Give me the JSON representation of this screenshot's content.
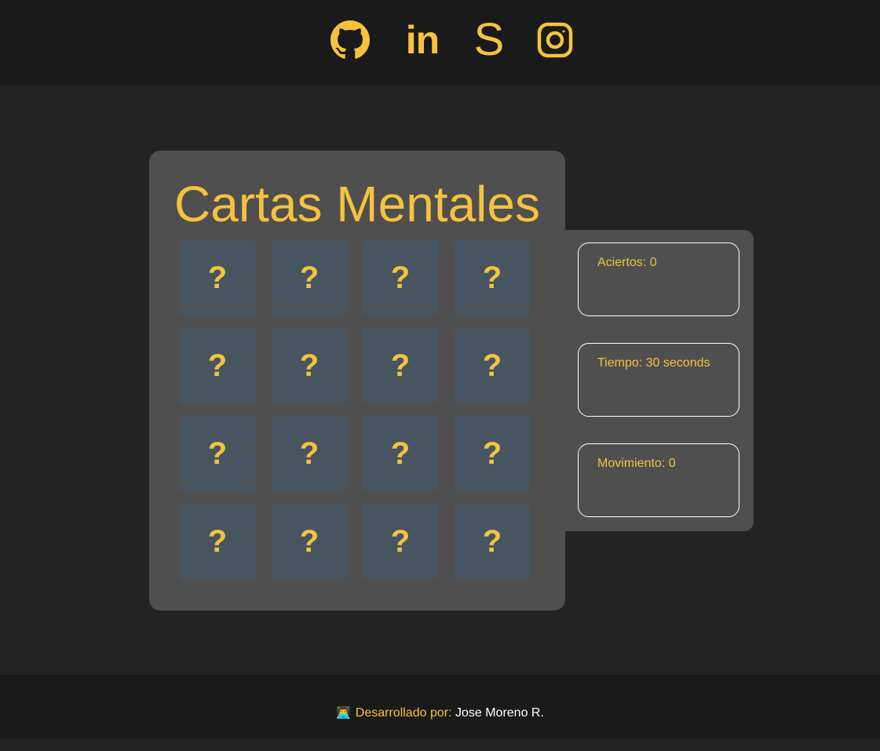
{
  "header": {
    "social": [
      {
        "name": "github-icon"
      },
      {
        "name": "linkedin-icon",
        "label": "in"
      },
      {
        "name": "stackoverflow-icon",
        "label": "S"
      },
      {
        "name": "instagram-icon"
      }
    ]
  },
  "game": {
    "title": "Cartas Mentales",
    "cards": [
      "?",
      "?",
      "?",
      "?",
      "?",
      "?",
      "?",
      "?",
      "?",
      "?",
      "?",
      "?",
      "?",
      "?",
      "?",
      "?"
    ]
  },
  "stats": {
    "hits": "Aciertos: 0",
    "time": "Tiempo: 30 seconds",
    "moves": "Movimiento: 0"
  },
  "footer": {
    "icon": "👨‍💻",
    "label": "Desarrollado por:",
    "name": "Jose Moreno R."
  },
  "colors": {
    "accent": "#f6c23e",
    "card": "#465560",
    "panel": "#4f4f4f",
    "header": "#1a1a1a",
    "background": "#232323"
  }
}
